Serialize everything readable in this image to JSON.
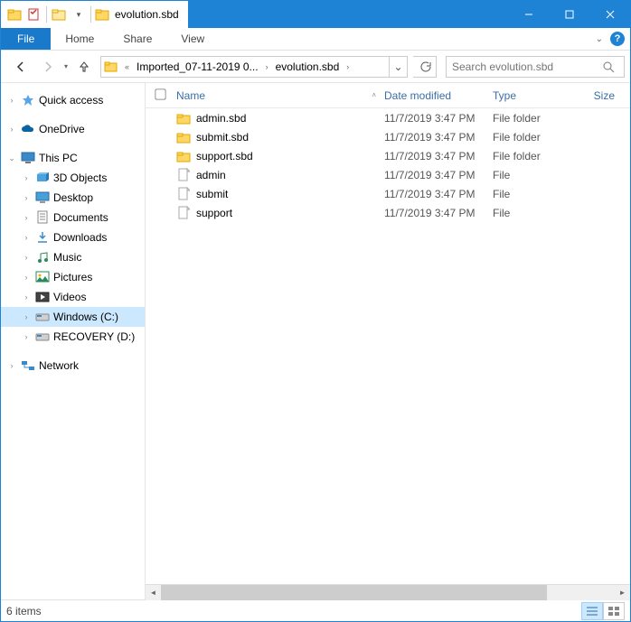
{
  "title": "evolution.sbd",
  "ribbon": {
    "file": "File",
    "home": "Home",
    "share": "Share",
    "view": "View"
  },
  "breadcrumb": {
    "seg1": "Imported_07-11-2019 0...",
    "seg2": "evolution.sbd"
  },
  "search": {
    "placeholder": "Search evolution.sbd"
  },
  "sidebar": {
    "quick": "Quick access",
    "onedrive": "OneDrive",
    "thispc": "This PC",
    "children": [
      "3D Objects",
      "Desktop",
      "Documents",
      "Downloads",
      "Music",
      "Pictures",
      "Videos",
      "Windows (C:)",
      "RECOVERY (D:)"
    ],
    "network": "Network"
  },
  "columns": {
    "name": "Name",
    "date": "Date modified",
    "type": "Type",
    "size": "Size"
  },
  "rows": [
    {
      "icon": "folder",
      "name": "admin.sbd",
      "date": "11/7/2019 3:47 PM",
      "type": "File folder",
      "size": ""
    },
    {
      "icon": "folder",
      "name": "submit.sbd",
      "date": "11/7/2019 3:47 PM",
      "type": "File folder",
      "size": ""
    },
    {
      "icon": "folder",
      "name": "support.sbd",
      "date": "11/7/2019 3:47 PM",
      "type": "File folder",
      "size": ""
    },
    {
      "icon": "file",
      "name": "admin",
      "date": "11/7/2019 3:47 PM",
      "type": "File",
      "size": ""
    },
    {
      "icon": "file",
      "name": "submit",
      "date": "11/7/2019 3:47 PM",
      "type": "File",
      "size": ""
    },
    {
      "icon": "file",
      "name": "support",
      "date": "11/7/2019 3:47 PM",
      "type": "File",
      "size": ""
    }
  ],
  "status": {
    "count": "6 items"
  }
}
